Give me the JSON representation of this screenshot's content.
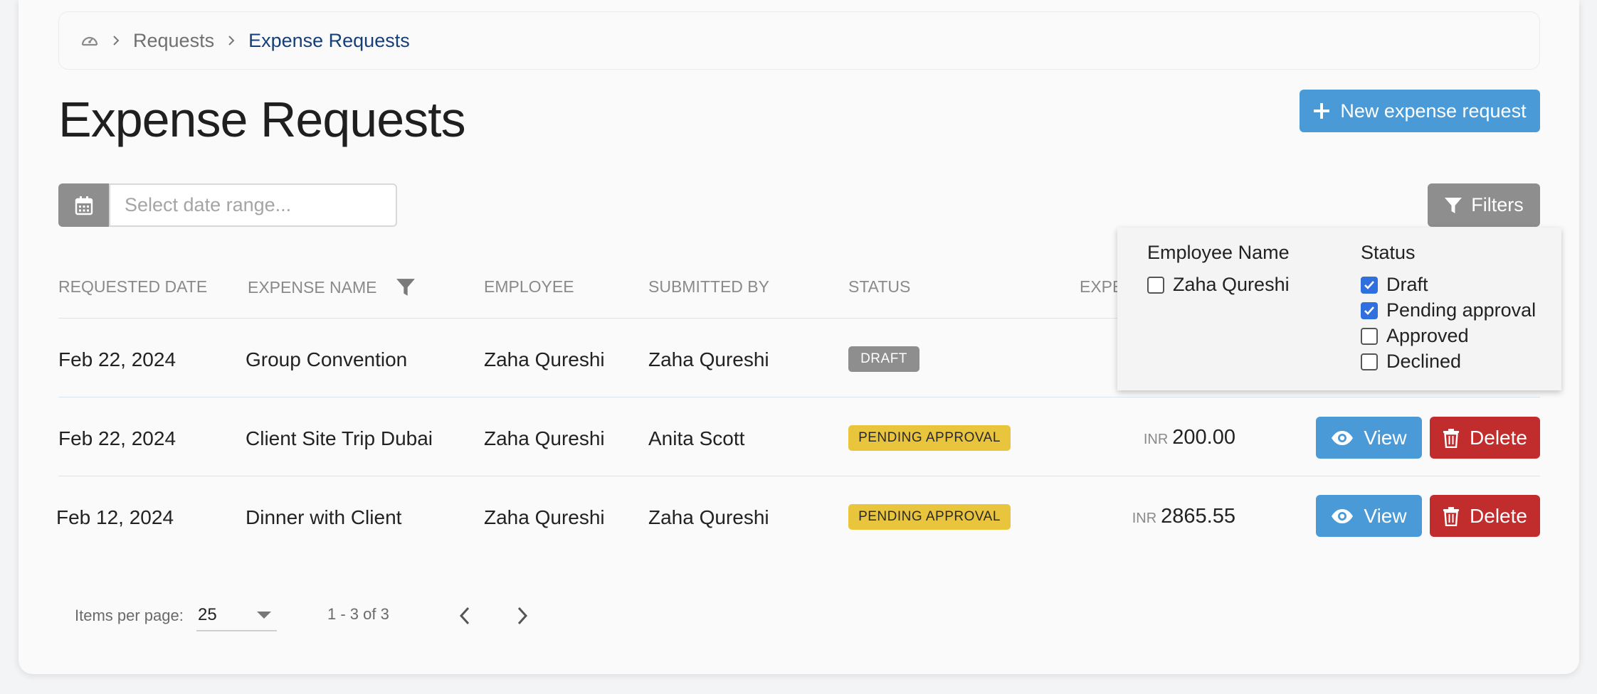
{
  "breadcrumb": {
    "home_icon": "dashboard-gauge-icon",
    "items": [
      "Requests",
      "Expense Requests"
    ]
  },
  "page": {
    "title": "Expense Requests",
    "new_button_label": "New expense request"
  },
  "toolbar": {
    "date_placeholder": "Select date range...",
    "filters_label": "Filters"
  },
  "table": {
    "headers": [
      "REQUESTED DATE",
      "EXPENSE NAME",
      "EMPLOYEE",
      "SUBMITTED BY",
      "STATUS",
      "EXPE"
    ],
    "rows": [
      {
        "date": "Feb 22, 2024",
        "name": "Group Convention",
        "employee": "Zaha Qureshi",
        "submitted_by": "Zaha Qureshi",
        "status": "DRAFT",
        "currency": "",
        "amount": ""
      },
      {
        "date": "Feb 22, 2024",
        "name": "Client Site Trip Dubai",
        "employee": "Zaha Qureshi",
        "submitted_by": "Anita Scott",
        "status": "PENDING APPROVAL",
        "currency": "INR",
        "amount": "200.00"
      },
      {
        "date": "Feb 12, 2024",
        "name": "Dinner with Client",
        "employee": "Zaha Qureshi",
        "submitted_by": "Zaha Qureshi",
        "status": "PENDING APPROVAL",
        "currency": "INR",
        "amount": "2865.55"
      }
    ],
    "view_label": "View",
    "delete_label": "Delete"
  },
  "filter_panel": {
    "employee_heading": "Employee Name",
    "employees": [
      {
        "label": "Zaha Qureshi",
        "checked": false
      }
    ],
    "status_heading": "Status",
    "statuses": [
      {
        "label": "Draft",
        "checked": true
      },
      {
        "label": "Pending approval",
        "checked": true
      },
      {
        "label": "Approved",
        "checked": false
      },
      {
        "label": "Declined",
        "checked": false
      }
    ]
  },
  "pagination": {
    "items_per_page_label": "Items per page:",
    "items_per_page_value": "25",
    "range_label": "1 - 3 of 3"
  },
  "colors": {
    "primary": "#4a9ad8",
    "danger": "#c12c2c",
    "pending": "#e9c53d",
    "neutral": "#8e8e8e",
    "breadcrumb_current": "#163f7a"
  }
}
